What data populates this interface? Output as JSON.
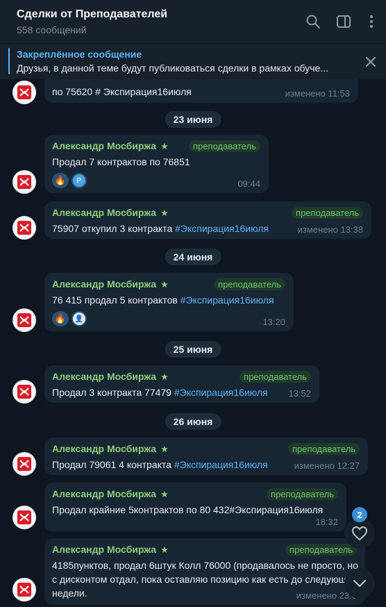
{
  "header": {
    "title": "Сделки от Преподавателей",
    "subtitle": "558 сообщений"
  },
  "pinned": {
    "title": "Закреплённое сообщение",
    "text": "Друзья, в данной теме будут публиковаться сделки в рамках обуче..."
  },
  "messages": [
    {
      "author": "",
      "tag": "",
      "text": "по 75620 # Экспирация16июля",
      "time": "изменено 11:53"
    },
    {
      "date": "23 июня",
      "author": "Александр Мосбиржа",
      "tag": "преподаватель",
      "text": "Продал 7 контрактов по 76851",
      "reactions": [
        "🔥",
        "P"
      ],
      "time": "09:44"
    },
    {
      "author": "Александр Мосбиржа",
      "tag": "преподаватель",
      "text_plain": "75907 откупил 3 контракта ",
      "hashtag": "#Экспирация16июля",
      "time": "изменено 13:38"
    },
    {
      "date": "24 июня",
      "author": "Александр Мосбиржа",
      "tag": "преподаватель",
      "text_plain": "76 415 продал 5 контрактов ",
      "hashtag": "#Экспирация16июля",
      "reactions": [
        "🔥",
        "👤"
      ],
      "time": "13:20"
    },
    {
      "date": "25 июня",
      "author": "Александр Мосбиржа",
      "tag": "преподаватель",
      "text_plain": "Продал 3 контракта 77479 ",
      "hashtag": "#Экспирация16июля",
      "time": "13:52"
    },
    {
      "date": "26 июня",
      "author": "Александр Мосбиржа",
      "tag": "преподаватель",
      "text_plain": "Продал 79061 4 контракта ",
      "hashtag": "#Экспирация16июля",
      "time": "изменено 12:27"
    },
    {
      "author": "Александр Мосбиржа",
      "tag": "преподаватель",
      "text": "Продал крайние 5контрактов по 80 432#Экспирация16июля",
      "time": "18:32"
    },
    {
      "author": "Александр Мосбиржа",
      "tag": "преподаватель",
      "text": "4185пунктов, продал 6штук Колл 76000 (продавалось не просто, но с дисконтом отдал, пока оставляю позицию как есть до следующей недели.",
      "time": "изменено 23:0"
    }
  ],
  "fab": {
    "unread_count": "2"
  },
  "icons": {
    "search": "search-icon",
    "sidebar": "sidebar-toggle-icon",
    "menu": "more-vertical-icon",
    "close": "close-icon",
    "heart": "heart-icon",
    "scroll_down": "chevron-down-icon",
    "avatar": "moex-logo-icon"
  },
  "colors": {
    "background": "#0e1621",
    "bubble": "#182533",
    "author": "#8ccf79",
    "link": "#5eb5f7",
    "avatar_logo": "#d71f2a"
  }
}
